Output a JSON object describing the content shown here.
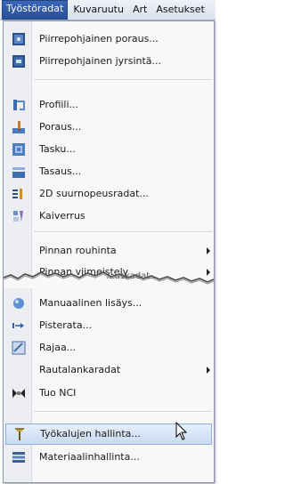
{
  "menubar": {
    "items": [
      {
        "label": "Työstöradat",
        "active": true
      },
      {
        "label": "Kuvaruutu",
        "active": false
      },
      {
        "label": "Art",
        "active": false
      },
      {
        "label": "Asetukset",
        "active": false
      }
    ]
  },
  "menu": {
    "items": [
      {
        "label": "Piirrepohjainen poraus...",
        "icon": "feature-drill-icon"
      },
      {
        "label": "Piirrepohjainen jyrsintä...",
        "icon": "feature-mill-icon"
      },
      {
        "label": "Profiili...",
        "icon": "profile-icon"
      },
      {
        "label": "Poraus...",
        "icon": "drill-icon"
      },
      {
        "label": "Tasku...",
        "icon": "pocket-icon"
      },
      {
        "label": "Tasaus...",
        "icon": "face-icon"
      },
      {
        "label": "2D suurnopeusradat...",
        "icon": "high-speed-icon"
      },
      {
        "label": "Kaiverrus",
        "icon": "engrave-icon"
      },
      {
        "label": "Pinnan rouhinta",
        "has_submenu": true
      },
      {
        "label": "Pinnan viimeistely",
        "has_submenu": true
      },
      {
        "label": "...uskadat...",
        "partial": true
      },
      {
        "label": "Manuaalinen lisäys...",
        "icon": "manual-entry-icon"
      },
      {
        "label": "Pisterata...",
        "icon": "point-path-icon"
      },
      {
        "label": "Rajaa...",
        "icon": "trim-icon"
      },
      {
        "label": "Rautalankaradat",
        "has_submenu": true
      },
      {
        "label": "Tuo NCI",
        "icon": "import-nci-icon"
      },
      {
        "label": "Työkalujen hallinta...",
        "icon": "tool-manager-icon",
        "highlighted": true
      },
      {
        "label": "Materiaalinhallinta...",
        "icon": "material-manager-icon"
      }
    ]
  },
  "colors": {
    "active_menu": "#2a4f9c",
    "highlight": "#c9daf3"
  }
}
